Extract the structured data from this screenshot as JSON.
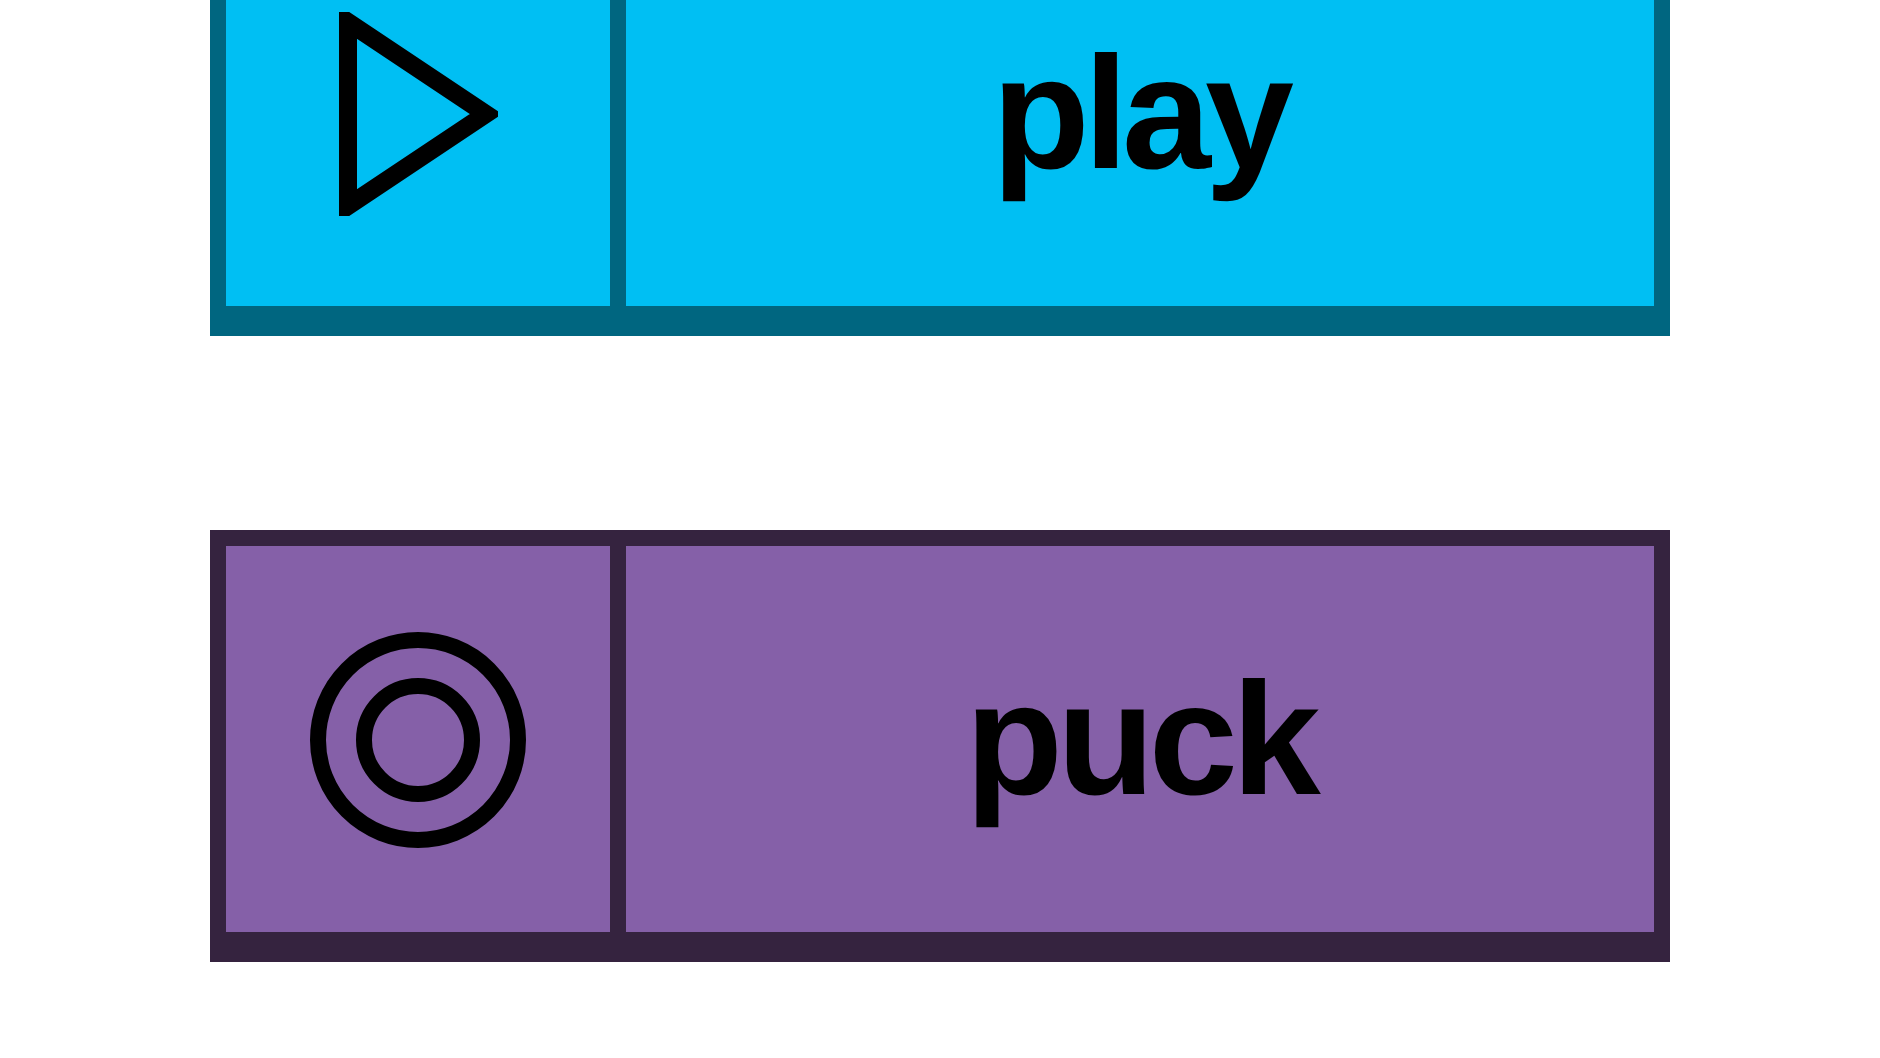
{
  "buttons": [
    {
      "kind": "play",
      "label": "play",
      "color": "#00bff3"
    },
    {
      "kind": "puck",
      "label": "puck",
      "color": "#8560a8"
    }
  ]
}
